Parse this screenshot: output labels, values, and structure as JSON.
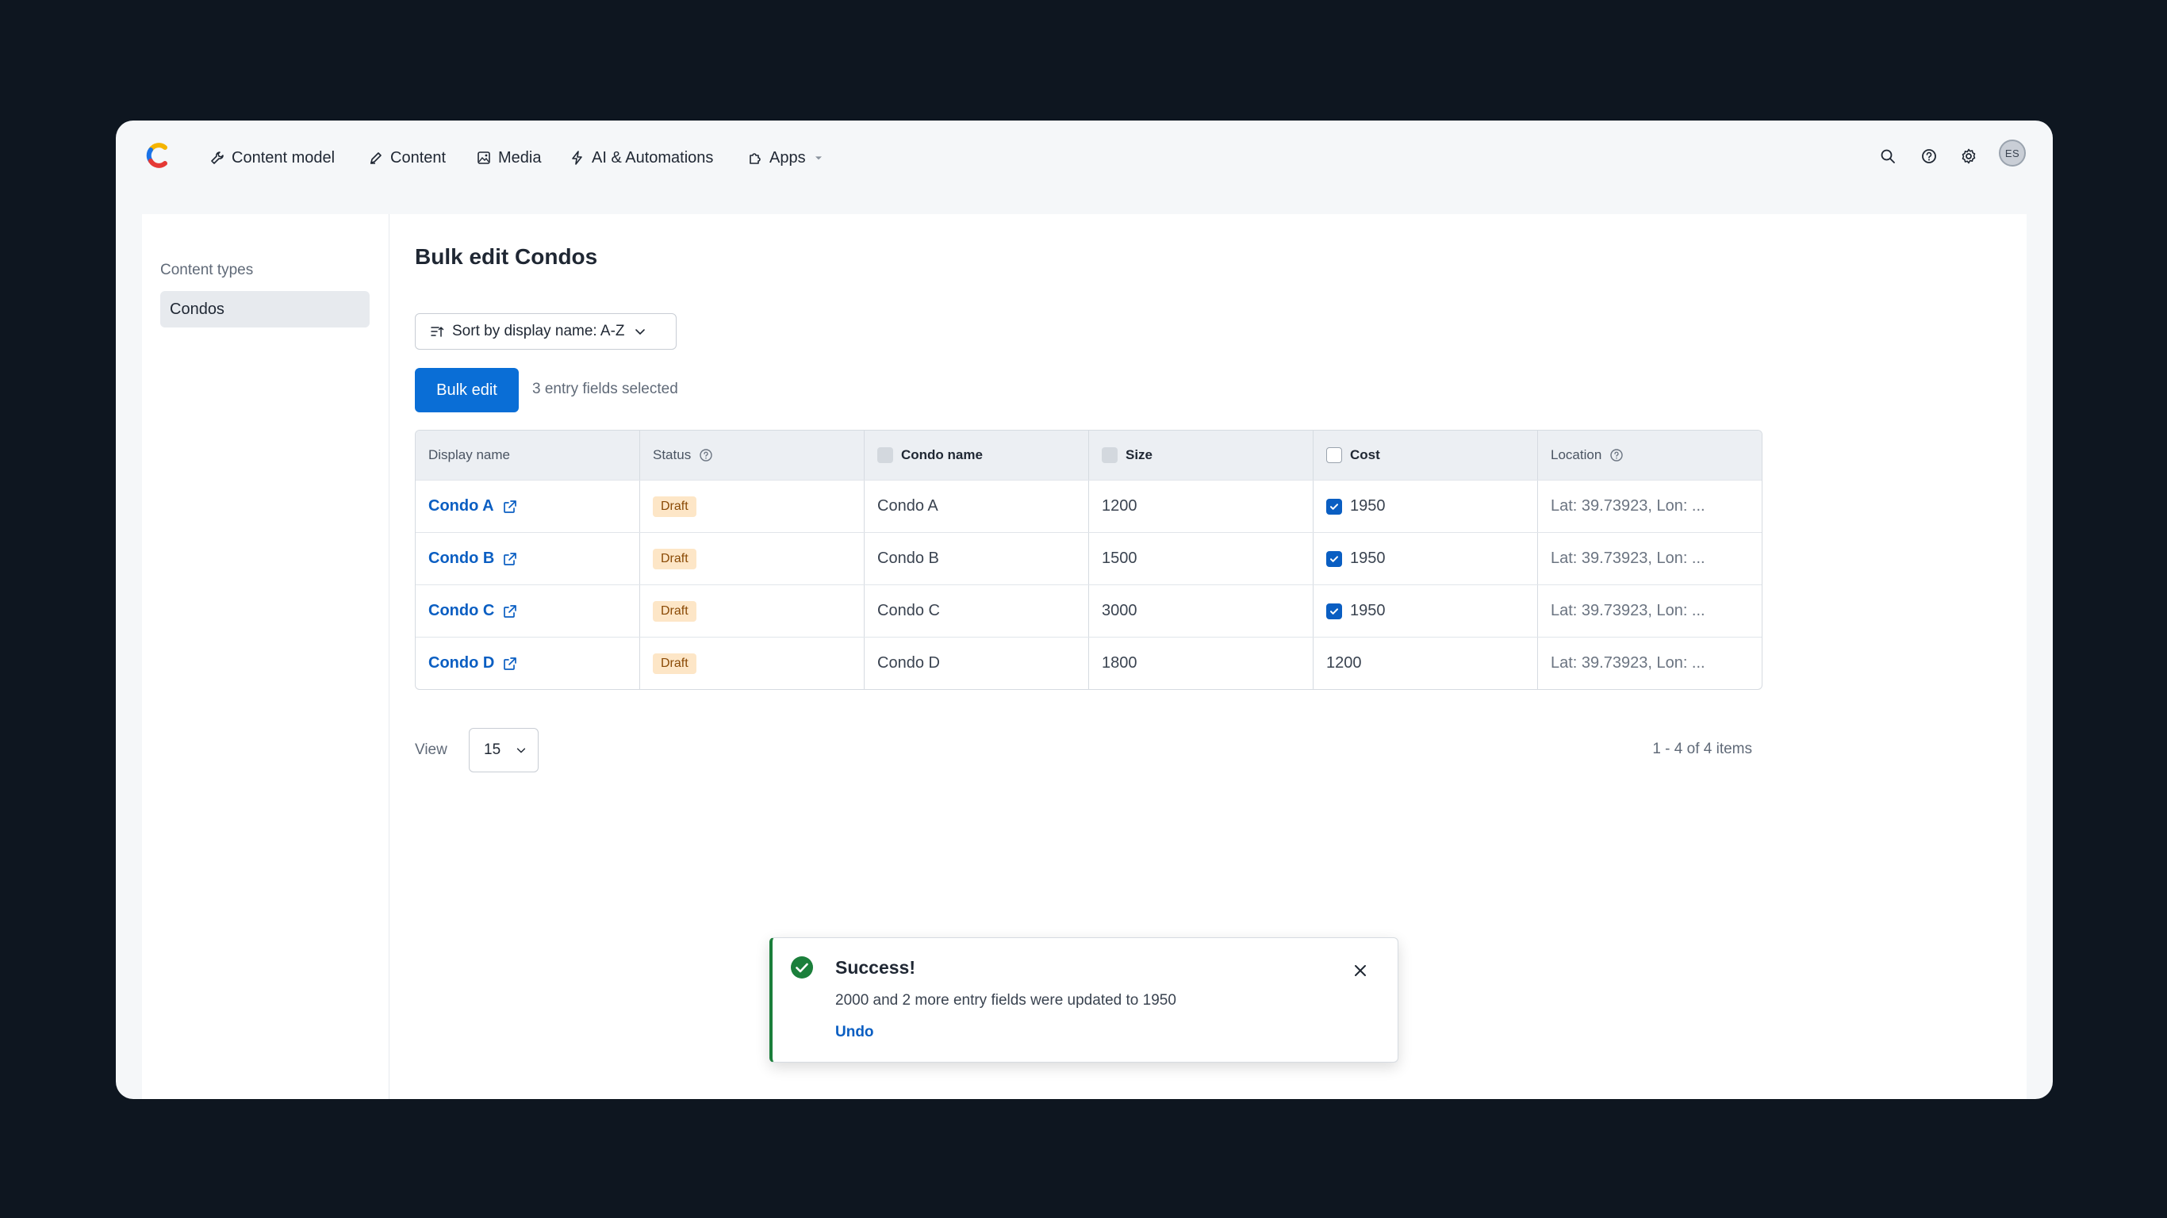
{
  "nav": {
    "items": [
      {
        "label": "Content model",
        "icon": "wrench-icon"
      },
      {
        "label": "Content",
        "icon": "pen-icon"
      },
      {
        "label": "Media",
        "icon": "image-icon"
      },
      {
        "label": "AI & Automations",
        "icon": "bolt-icon"
      },
      {
        "label": "Apps",
        "icon": "puzzle-icon"
      }
    ],
    "avatar_initials": "ES"
  },
  "sidebar": {
    "heading": "Content types",
    "items": [
      {
        "label": "Condos",
        "selected": true
      }
    ]
  },
  "main": {
    "title": "Bulk edit Condos",
    "sort_label": "Sort by display name: A-Z",
    "bulk_edit_label": "Bulk edit",
    "selected_text": "3 entry fields selected"
  },
  "table": {
    "headers": [
      "Display name",
      "Status",
      "Condo name",
      "Size",
      "Cost",
      "Location"
    ],
    "rows": [
      {
        "display_name": "Condo A",
        "status": "Draft",
        "condo_name": "Condo A",
        "size": "1200",
        "cost": "1950",
        "cost_checked": true,
        "location": "Lat: 39.73923, Lon: ..."
      },
      {
        "display_name": "Condo B",
        "status": "Draft",
        "condo_name": "Condo B",
        "size": "1500",
        "cost": "1950",
        "cost_checked": true,
        "location": "Lat: 39.73923, Lon: ..."
      },
      {
        "display_name": "Condo C",
        "status": "Draft",
        "condo_name": "Condo C",
        "size": "3000",
        "cost": "1950",
        "cost_checked": true,
        "location": "Lat: 39.73923, Lon: ..."
      },
      {
        "display_name": "Condo D",
        "status": "Draft",
        "condo_name": "Condo D",
        "size": "1800",
        "cost": "1200",
        "cost_checked": false,
        "location": "Lat: 39.73923, Lon: ..."
      }
    ]
  },
  "footer": {
    "view_label": "View",
    "page_size": "15",
    "pagination": "1 - 4 of 4 items"
  },
  "toast": {
    "title": "Success!",
    "message": "2000 and 2 more entry fields were updated to 1950",
    "undo_label": "Undo"
  },
  "colors": {
    "background": "#0e1620",
    "primary": "#0a6ed6",
    "link": "#0a5ec2",
    "success": "#1b7f3b",
    "draft_badge": "#fde6c7"
  }
}
